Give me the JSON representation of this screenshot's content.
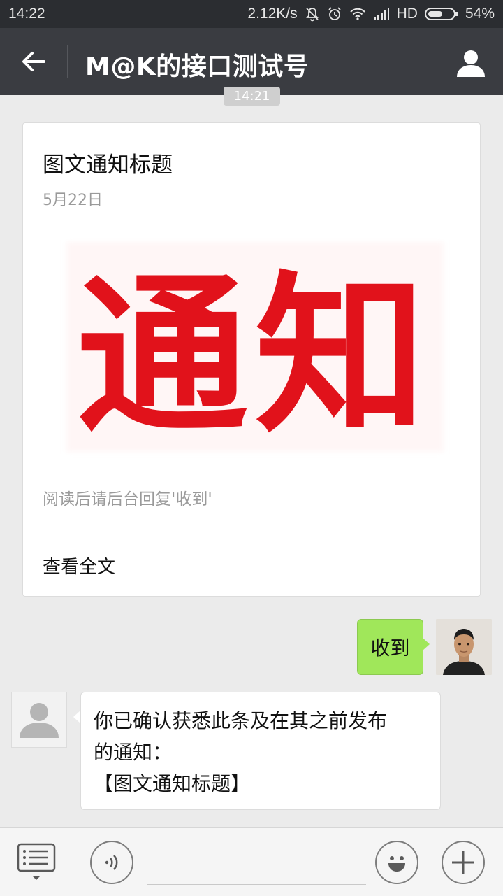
{
  "status_bar": {
    "time": "14:22",
    "network_speed": "2.12K/s",
    "network_type": "HD",
    "battery": "54%",
    "icons": [
      "mute-icon",
      "alarm-icon",
      "wifi-icon",
      "signal-icon",
      "battery-icon"
    ]
  },
  "header": {
    "title": "M@K的接口测试号",
    "back_icon": "arrow-left-icon",
    "profile_icon": "user-icon"
  },
  "time_badge": "14:21",
  "card": {
    "title": "图文通知标题",
    "date": "5月22日",
    "image_text": "通知",
    "summary": "阅读后请后台回复'收到'",
    "read_more": "查看全文"
  },
  "messages": [
    {
      "direction": "outgoing",
      "text": "收到"
    },
    {
      "direction": "incoming",
      "lines": [
        "你已确认获悉此条及在其之前发布",
        "的通知：",
        "【图文通知标题】"
      ]
    }
  ],
  "toolbar": {
    "menu_icon": "menu-list-icon",
    "voice_icon": "voice-icon",
    "emoji_icon": "emoji-icon",
    "plus_icon": "plus-icon",
    "input_value": ""
  },
  "colors": {
    "header_bg": "#3a3c41",
    "statusbar_bg": "#2b2d31",
    "chat_bg": "#ebebeb",
    "outgoing_bubble": "#a0e75a",
    "notice_red": "#e1121b"
  }
}
